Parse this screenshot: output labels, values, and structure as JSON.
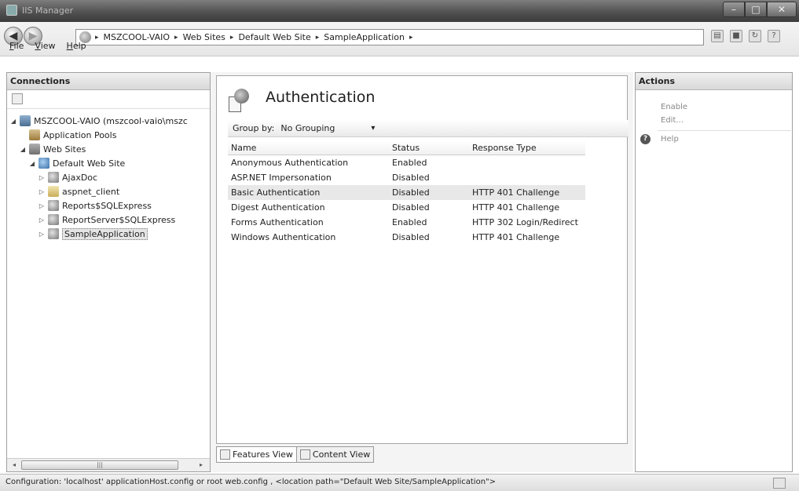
{
  "window": {
    "title": "IIS Manager"
  },
  "address": {
    "crumbs": [
      "MSZCOOL-VAIO",
      "Web Sites",
      "Default Web Site",
      "SampleApplication"
    ],
    "separator": "▸"
  },
  "menu": {
    "items": [
      "File",
      "View",
      "Help"
    ]
  },
  "connections": {
    "header": "Connections",
    "tree": [
      {
        "label": "MSZCOOL-VAIO (mszcool-vaio\\mszc",
        "icon": "server-icon",
        "expanded": true
      },
      {
        "label": "Application Pools",
        "icon": "app-pools-icon"
      },
      {
        "label": "Web Sites",
        "icon": "sites-folder-icon",
        "expanded": true
      },
      {
        "label": "Default Web Site",
        "icon": "globe-icon",
        "expanded": true
      },
      {
        "label": "AjaxDoc",
        "icon": "application-icon"
      },
      {
        "label": "aspnet_client",
        "icon": "folder-icon"
      },
      {
        "label": "Reports$SQLExpress",
        "icon": "application-icon"
      },
      {
        "label": "ReportServer$SQLExpress",
        "icon": "application-icon"
      },
      {
        "label": "SampleApplication",
        "icon": "application-icon",
        "selected": true
      }
    ]
  },
  "feature": {
    "title": "Authentication",
    "group_by_label": "Group by:",
    "group_by_value": "No Grouping",
    "columns": [
      "Name",
      "Status",
      "Response Type"
    ],
    "rows": [
      {
        "name": "Anonymous Authentication",
        "status": "Enabled",
        "response": ""
      },
      {
        "name": "ASP.NET Impersonation",
        "status": "Disabled",
        "response": ""
      },
      {
        "name": "Basic Authentication",
        "status": "Disabled",
        "response": "HTTP 401 Challenge",
        "selected": true
      },
      {
        "name": "Digest Authentication",
        "status": "Disabled",
        "response": "HTTP 401 Challenge"
      },
      {
        "name": "Forms Authentication",
        "status": "Enabled",
        "response": "HTTP 302 Login/Redirect"
      },
      {
        "name": "Windows Authentication",
        "status": "Disabled",
        "response": "HTTP 401 Challenge"
      }
    ],
    "tabs": [
      "Features View",
      "Content View"
    ]
  },
  "actions": {
    "header": "Actions",
    "enable": "Enable",
    "edit": "Edit...",
    "help": "Help"
  },
  "status": {
    "text": "Configuration: 'localhost' applicationHost.config or root web.config , <location path=\"Default Web Site/SampleApplication\">"
  }
}
